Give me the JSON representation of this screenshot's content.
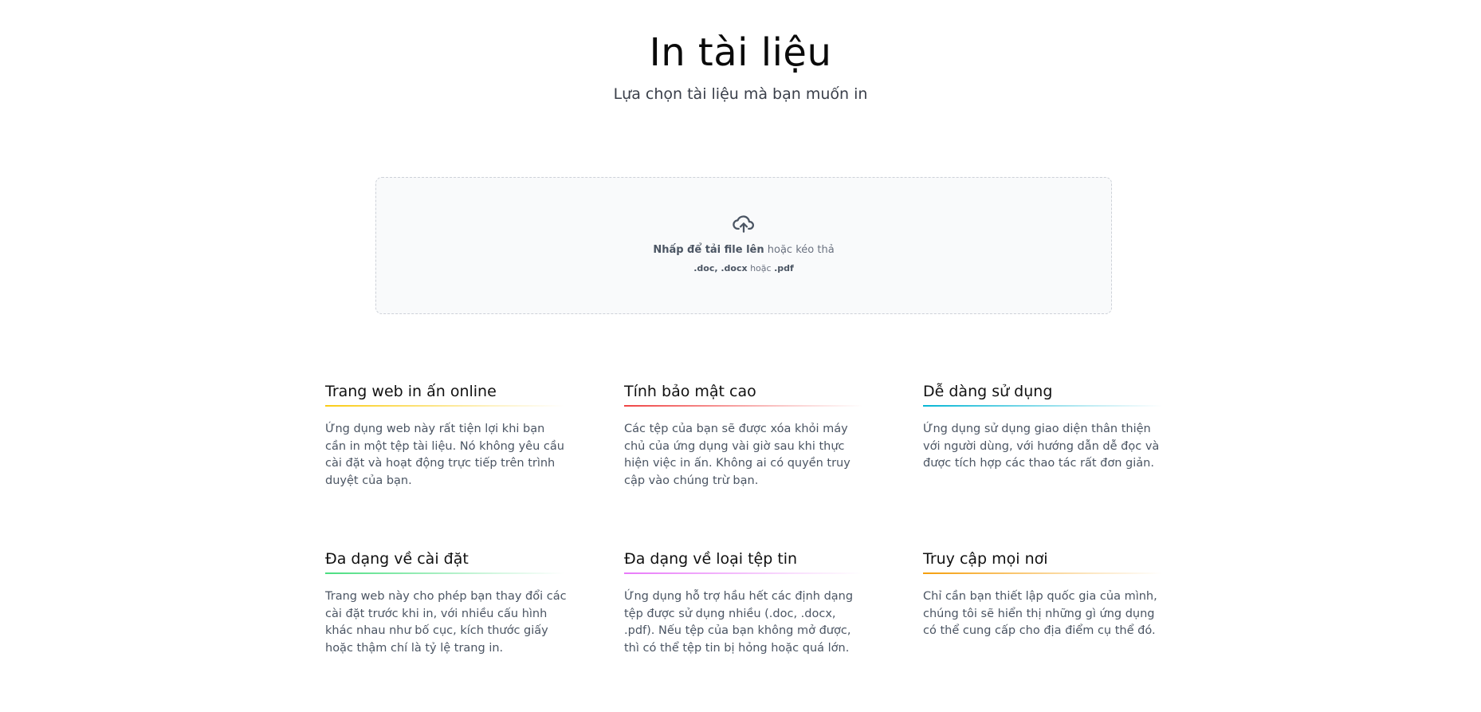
{
  "header": {
    "title": "In tài liệu",
    "subtitle": "Lựa chọn tài liệu mà bạn muốn in"
  },
  "upload": {
    "icon": "cloud-upload-icon",
    "click_text": "Nhấp để tải file lên",
    "drag_text": " hoặc kéo thả",
    "format_docs": ".doc, .docx",
    "format_or": " hoặc ",
    "format_pdf": ".pdf"
  },
  "features": [
    {
      "title": "Trang web in ấn online",
      "color": "#facc15",
      "description": "Ứng dụng web này rất tiện lợi khi bạn cần in một tệp tài liệu. Nó không yêu cầu cài đặt và hoạt động trực tiếp trên trình duyệt của bạn."
    },
    {
      "title": "Tính bảo mật cao",
      "color": "#ef4444",
      "description": "Các tệp của bạn sẽ được xóa khỏi máy chủ của ứng dụng vài giờ sau khi thực hiện việc in ấn. Không ai có quyền truy cập vào chúng trừ bạn."
    },
    {
      "title": "Dễ dàng sử dụng",
      "color": "#06b6d4",
      "description": "Ứng dụng sử dụng giao diện thân thiện với người dùng, với hướng dẫn dễ đọc và được tích hợp các thao tác rất đơn giản."
    },
    {
      "title": "Đa dạng về cài đặt",
      "color": "#4ade80",
      "description": "Trang web này cho phép bạn thay đổi các cài đặt trước khi in, với nhiều cấu hình khác nhau như bố cục, kích thước giấy hoặc thậm chí là tỷ lệ trang in."
    },
    {
      "title": "Đa dạng về loại tệp tin",
      "color": "#e879f9",
      "description": "Ứng dụng hỗ trợ hầu hết các định dạng tệp được sử dụng nhiều (.doc, .docx, .pdf). Nếu tệp của bạn không mở được, thì có thể tệp tin bị hỏng hoặc quá lớn."
    },
    {
      "title": "Truy cập mọi nơi",
      "color": "#f59e0b",
      "description": "Chỉ cần bạn thiết lập quốc gia của mình, chúng tôi sẽ hiển thị những gì ứng dụng có thể cung cấp cho địa điểm cụ thể đó."
    }
  ]
}
